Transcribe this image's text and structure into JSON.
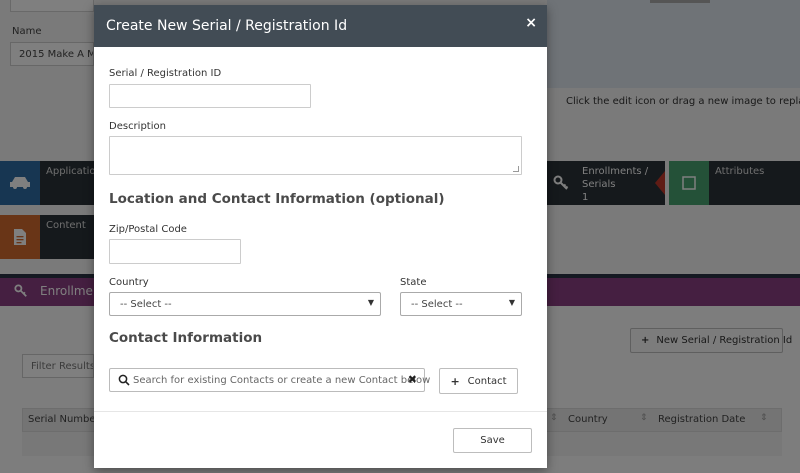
{
  "background": {
    "name_label": "Name",
    "name_value": "2015 Make A Mo",
    "image_caption": "Click the edit icon or drag a new image to replace",
    "tiles": {
      "applications": "Applicatio",
      "content": "Content",
      "enrollments": "Enrollments / Serials",
      "enrollments_line1": "Enrollments /",
      "enrollments_line2": "Serials",
      "enrollments_count": "1",
      "attributes": "Attributes"
    },
    "section_title": "Enrollme",
    "new_serial_button": "New Serial / Registration Id",
    "filter_placeholder": "Filter Results",
    "table_headers": {
      "serial_number": "Serial Number",
      "country": "Country",
      "registration_date": "Registration Date"
    }
  },
  "modal": {
    "title": "Create New Serial / Registration Id",
    "close_symbol": "×",
    "serial_label": "Serial / Registration ID",
    "serial_value": "",
    "description_label": "Description",
    "description_value": "",
    "location_heading": "Location and Contact Information (optional)",
    "zip_label": "Zip/Postal Code",
    "zip_value": "",
    "country_label": "Country",
    "country_selected": "-- Select --",
    "state_label": "State",
    "state_selected": "-- Select --",
    "contact_heading": "Contact Information",
    "contact_search_placeholder": "Search for existing Contacts or create a new Contact below",
    "contact_button": "Contact",
    "save_button": "Save"
  },
  "icons": {
    "close": "close-icon",
    "search": "search-icon",
    "plus": "plus-icon",
    "car": "car-icon",
    "document": "document-icon",
    "key": "key-icon",
    "checkbox": "checkbox-icon",
    "sort": "sort-icon",
    "caret": "caret-down-icon"
  },
  "colors": {
    "modal_header": "#424c55",
    "enrollment_bar": "#8b3f83",
    "app_tile_icon": "#2e6da4",
    "content_tile_icon": "#d36b2e",
    "attributes_tile_icon": "#48a270",
    "enrollments_arrow": "#c0392b"
  }
}
